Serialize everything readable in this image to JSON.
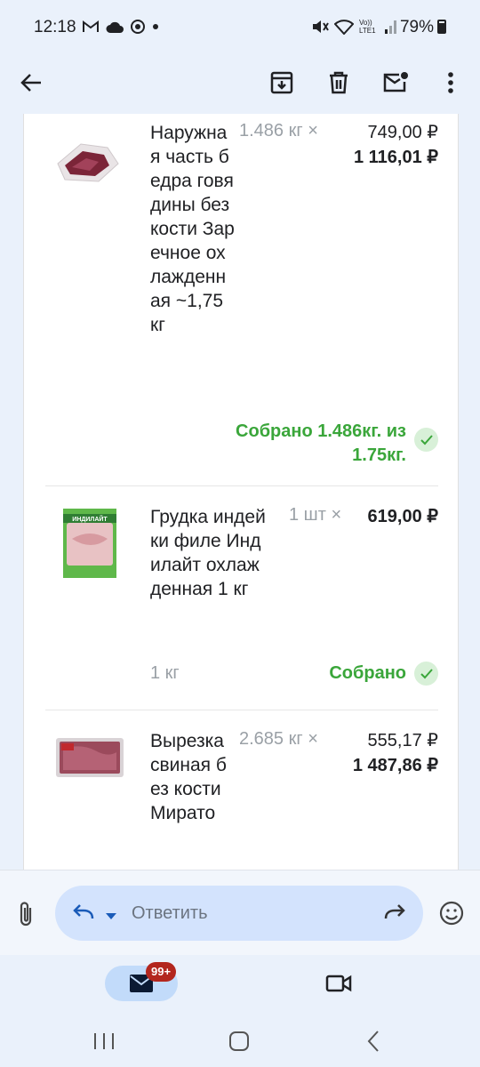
{
  "status_bar": {
    "time": "12:18",
    "battery": "79%",
    "left_icons": [
      "gmail-icon",
      "cloud-icon",
      "sync-icon",
      "dot-icon"
    ],
    "right_icons": [
      "mute-icon",
      "wifi-icon",
      "volte-icon",
      "signal-icon",
      "battery-icon"
    ],
    "volte_label": "Vo)) LTE1"
  },
  "app_bar": {
    "icons": [
      "back-arrow-icon",
      "archive-icon",
      "delete-icon",
      "mark-unread-icon",
      "more-vert-icon"
    ]
  },
  "items": [
    {
      "name": "Наружная часть бедра говядины без кости Заречное охлажденная ~1,75 кг",
      "qty": "1.486 кг ×",
      "unit_price": "749,00 ₽",
      "total": "1 116,01 ₽",
      "status": "Собрано 1.486кг. из 1.75кг."
    },
    {
      "name": "Грудка индейки филе Индилайт охлажденная 1 кг",
      "qty": "1 шт ×",
      "unit_price": "619,00 ₽",
      "unit": "1 кг",
      "status": "Собрано",
      "package_brand": "ИНДИЛАЙТ"
    },
    {
      "name": "Вырезка свиная без кости Мирато",
      "qty": "2.685 кг ×",
      "unit_price": "555,17 ₽",
      "total": "1 487,86 ₽"
    }
  ],
  "reply": {
    "placeholder": "Ответить"
  },
  "bottom_nav": {
    "badge": "99+"
  },
  "colors": {
    "accent_green": "#3aa63a",
    "background": "#eaf1fb",
    "reply_pill": "#d3e3fd",
    "badge": "#b3261e"
  }
}
